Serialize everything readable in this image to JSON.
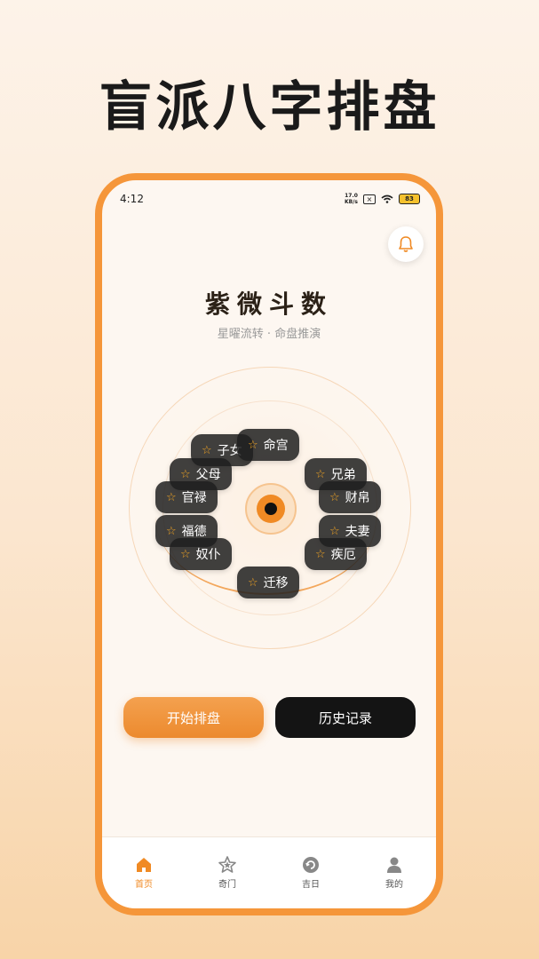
{
  "headline": "盲派八字排盘",
  "status_bar": {
    "time": "4:12",
    "net_speed_top": "17.0",
    "net_speed_bottom": "KB/s",
    "battery": "83"
  },
  "app": {
    "title": "紫微斗数",
    "subtitle": "星曜流转 · 命盘推演"
  },
  "palaces": [
    {
      "label": "子女"
    },
    {
      "label": "命宫"
    },
    {
      "label": "父母"
    },
    {
      "label": "兄弟"
    },
    {
      "label": "官禄"
    },
    {
      "label": "财帛"
    },
    {
      "label": "福德"
    },
    {
      "label": "夫妻"
    },
    {
      "label": "奴仆"
    },
    {
      "label": "疾厄"
    },
    {
      "label": "迁移"
    }
  ],
  "actions": {
    "start_label": "开始排盘",
    "history_label": "历史记录"
  },
  "tabs": [
    {
      "label": "首页",
      "icon": "home-icon",
      "active": true
    },
    {
      "label": "奇门",
      "icon": "star-icon",
      "active": false
    },
    {
      "label": "吉日",
      "icon": "refresh-icon",
      "active": false
    },
    {
      "label": "我的",
      "icon": "user-icon",
      "active": false
    }
  ],
  "colors": {
    "accent": "#f08a24",
    "phone_frame": "#f5963a",
    "chip_bg": "#1e1e1e",
    "star": "#f5a623"
  }
}
